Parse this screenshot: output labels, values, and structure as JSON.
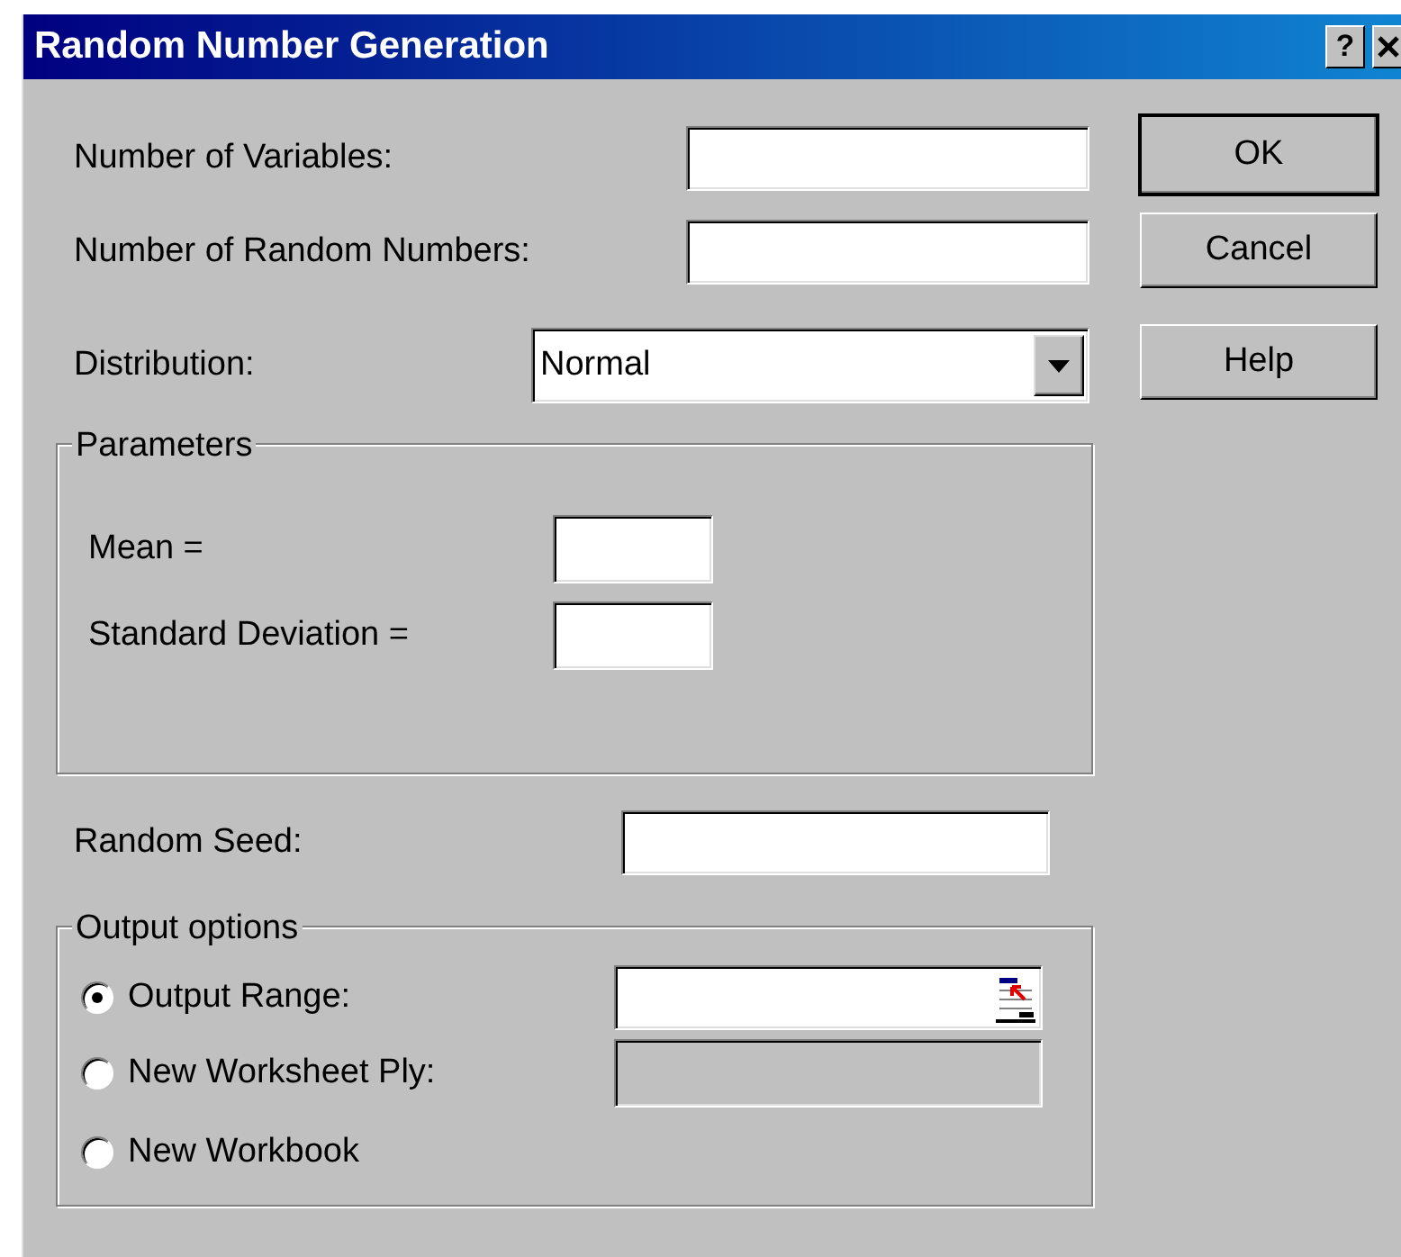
{
  "window": {
    "title": "Random Number Generation",
    "help_button": "?"
  },
  "fields": [
    {
      "kind": "text",
      "label": "Number of Variables:"
    },
    {
      "kind": "text",
      "label": "Number of Random Numbers:"
    },
    {
      "kind": "select",
      "label": "Distribution:",
      "value": "Normal"
    }
  ],
  "buttons": [
    {
      "label": "OK",
      "default": true
    },
    {
      "label": "Cancel",
      "default": false
    },
    {
      "label": "Help",
      "default": false
    }
  ],
  "parameters": {
    "title": "Parameters",
    "fields": [
      {
        "label": "Mean ="
      },
      {
        "label": "Standard Deviation ="
      }
    ]
  },
  "random_seed": {
    "label": "Random Seed:"
  },
  "output_options": {
    "title": "Output options",
    "options": [
      {
        "label": "Output Range:",
        "selected": true,
        "field": {
          "disabled": false,
          "range_button": true
        }
      },
      {
        "label": "New Worksheet Ply:",
        "selected": false,
        "field": {
          "disabled": true,
          "range_button": false
        }
      },
      {
        "label": "New Workbook",
        "selected": false
      }
    ]
  }
}
